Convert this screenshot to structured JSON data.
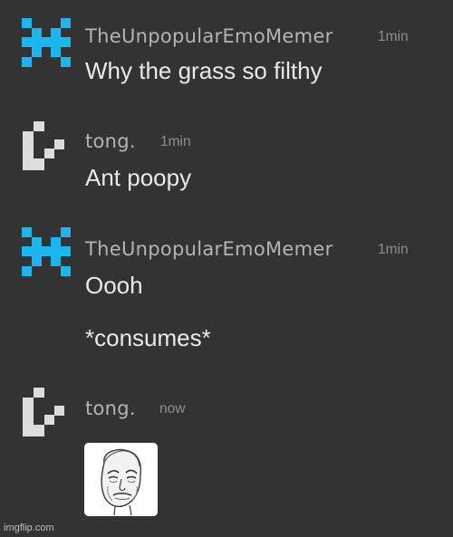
{
  "messages": [
    {
      "user": "TheUnpopularEmoMemer",
      "time": "1min",
      "lines": [
        "Why the grass so filthy"
      ]
    },
    {
      "user": "tong.",
      "time": "1min",
      "lines": [
        "Ant poopy"
      ]
    },
    {
      "user": "TheUnpopularEmoMemer",
      "time": "1min",
      "lines": [
        "Oooh",
        "*consumes*"
      ]
    },
    {
      "user": "tong.",
      "time": "now",
      "lines": []
    }
  ],
  "avatars": {
    "memer": "pixel-x-avatar-icon",
    "tong": "pixel-hook-avatar-icon"
  },
  "colors": {
    "background": "#333334",
    "memer_avatar": "#1ab6f0",
    "tong_avatar": "#dcdcdc",
    "name": "#b4b4b4",
    "text": "#e9e9e9",
    "timestamp": "#8e8e8e"
  },
  "image_message": {
    "icon": "okay-guy-meme-face-image"
  },
  "watermark": "imgflip.com"
}
